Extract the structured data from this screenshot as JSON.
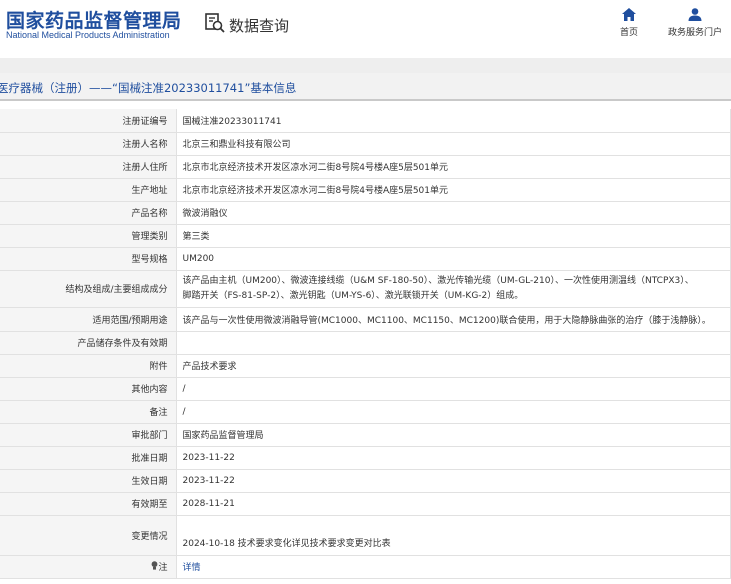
{
  "header": {
    "logo_cn": "国家药品监督管理局",
    "logo_en": "National Medical Products Administration",
    "search_title": "数据查询",
    "nav": {
      "home": "首页",
      "service": "政务服务门户"
    }
  },
  "section_title": "医疗器械（注册）——“国械注准20233011741”基本信息",
  "rows": [
    {
      "label": "注册证编号",
      "value": "国械注准20233011741"
    },
    {
      "label": "注册人名称",
      "value": "北京三和鼎业科技有限公司"
    },
    {
      "label": "注册人住所",
      "value": "北京市北京经济技术开发区凉水河二街8号院4号楼A座5层501单元"
    },
    {
      "label": "生产地址",
      "value": "北京市北京经济技术开发区凉水河二街8号院4号楼A座5层501单元"
    },
    {
      "label": "产品名称",
      "value": "微波消融仪"
    },
    {
      "label": "管理类别",
      "value": "第三类"
    },
    {
      "label": "型号规格",
      "value": "UM200"
    },
    {
      "label": "结构及组成/主要组成成分",
      "value_line1": "该产品由主机（UM200）、微波连接线缆（U&M SF-180-50）、激光传输光缆（UM-GL-210）、一次性使用测温线（NTCPX3）、",
      "value_line2": "脚踏开关（FS-81-SP-2）、激光钥匙（UM-YS-6）、激光联锁开关（UM-KG-2）组成。"
    },
    {
      "label": "适用范围/预期用途",
      "value": "该产品与一次性使用微波消融导管(MC1000、MC1100、MC1150、MC1200)联合使用，用于大隐静脉曲张的治疗（膝于浅静脉）。"
    },
    {
      "label": "产品储存条件及有效期",
      "value": ""
    },
    {
      "label": "附件",
      "value": "产品技术要求"
    },
    {
      "label": "其他内容",
      "value": "/"
    },
    {
      "label": "备注",
      "value": "/"
    },
    {
      "label": "审批部门",
      "value": "国家药品监督管理局"
    },
    {
      "label": "批准日期",
      "value": "2023-11-22"
    },
    {
      "label": "生效日期",
      "value": "2023-11-22"
    },
    {
      "label": "有效期至",
      "value": "2028-11-21"
    },
    {
      "label": "变更情况",
      "value": "2024-10-18 技术要求变化详见技术要求变更对比表"
    },
    {
      "label": "注",
      "value": "详情"
    }
  ],
  "colors": {
    "brand_blue": "#1f4e9e",
    "label_bg": "#f5f5f5",
    "border": "#e1e1e1"
  },
  "icons": {
    "search": "magnifier-document-icon",
    "home": "home-icon",
    "service": "user-icon",
    "note": "lightbulb-icon"
  }
}
